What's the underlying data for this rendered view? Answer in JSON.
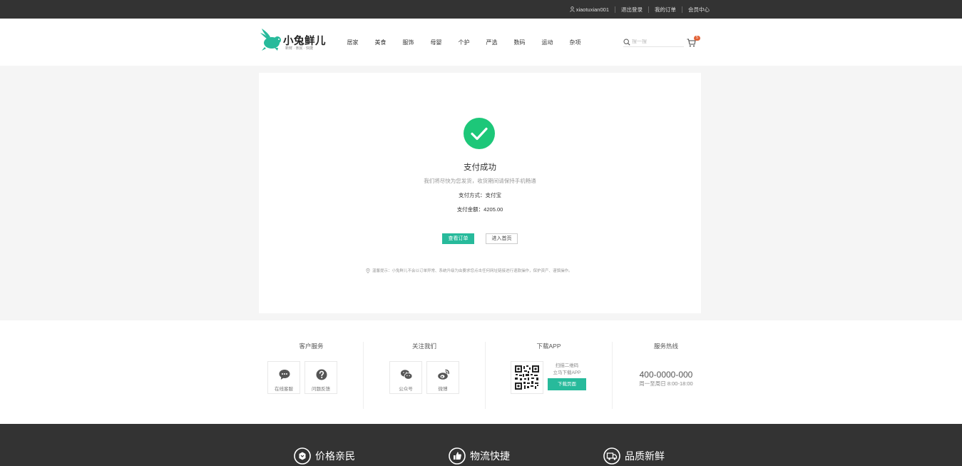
{
  "topbar": {
    "username": "xiaotuxian001",
    "logout": "退出登录",
    "my_orders": "我的订单",
    "member_center": "会员中心"
  },
  "header": {
    "logo_name": "小兔鲜儿",
    "logo_slogan": "新鲜 · 亲民 · 快捷",
    "nav": [
      "居家",
      "美食",
      "服饰",
      "母婴",
      "个护",
      "严选",
      "数码",
      "运动",
      "杂项"
    ],
    "search_placeholder": "搜一搜",
    "cart_count": "5"
  },
  "payment": {
    "title": "支付成功",
    "tip": "我们将尽快为您发货，收货期间请保持手机畅通",
    "method_label": "支付方式：支付宝",
    "amount_label": "支付金额：4205.00",
    "view_order": "查看订单",
    "go_home": "进入首页",
    "notice": "温馨提示：小兔鲜儿不会以订单异常、系统升级为由要求您点击任何网址链接进行退款操作，保护资产、谨慎操作。"
  },
  "service": {
    "customer_title": "客户服务",
    "online_service": "在线客服",
    "feedback": "问题反馈",
    "follow_title": "关注我们",
    "wechat": "公众号",
    "weibo": "微博",
    "app_title": "下载APP",
    "scan_text": "扫描二维码",
    "download_text": "立马下载APP",
    "download_button": "下载页面",
    "hotline_title": "服务热线",
    "hotline": "400-0000-000",
    "hours": "周一至周日 8:00-18:00"
  },
  "footer": {
    "features": [
      "价格亲民",
      "物流快捷",
      "品质新鲜"
    ]
  },
  "colors": {
    "brand": "#27ba9b",
    "topbar": "#333333",
    "badge": "#e26237"
  }
}
